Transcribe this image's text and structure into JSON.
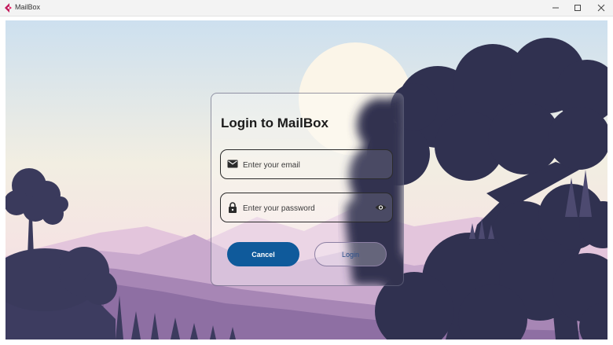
{
  "window": {
    "title": "MailBox",
    "controls": [
      "minimize",
      "maximize",
      "close"
    ]
  },
  "login": {
    "heading": "Login to MailBox",
    "email_placeholder": "Enter your email",
    "password_placeholder": "Enter your password",
    "cancel_label": "Cancel",
    "login_label": "Login"
  },
  "icons": {
    "email": "envelope-icon",
    "password": "lock-icon",
    "reveal": "eye-icon"
  },
  "colors": {
    "primary_button": "#0f5a9b",
    "tree_silhouette": "#303150"
  }
}
